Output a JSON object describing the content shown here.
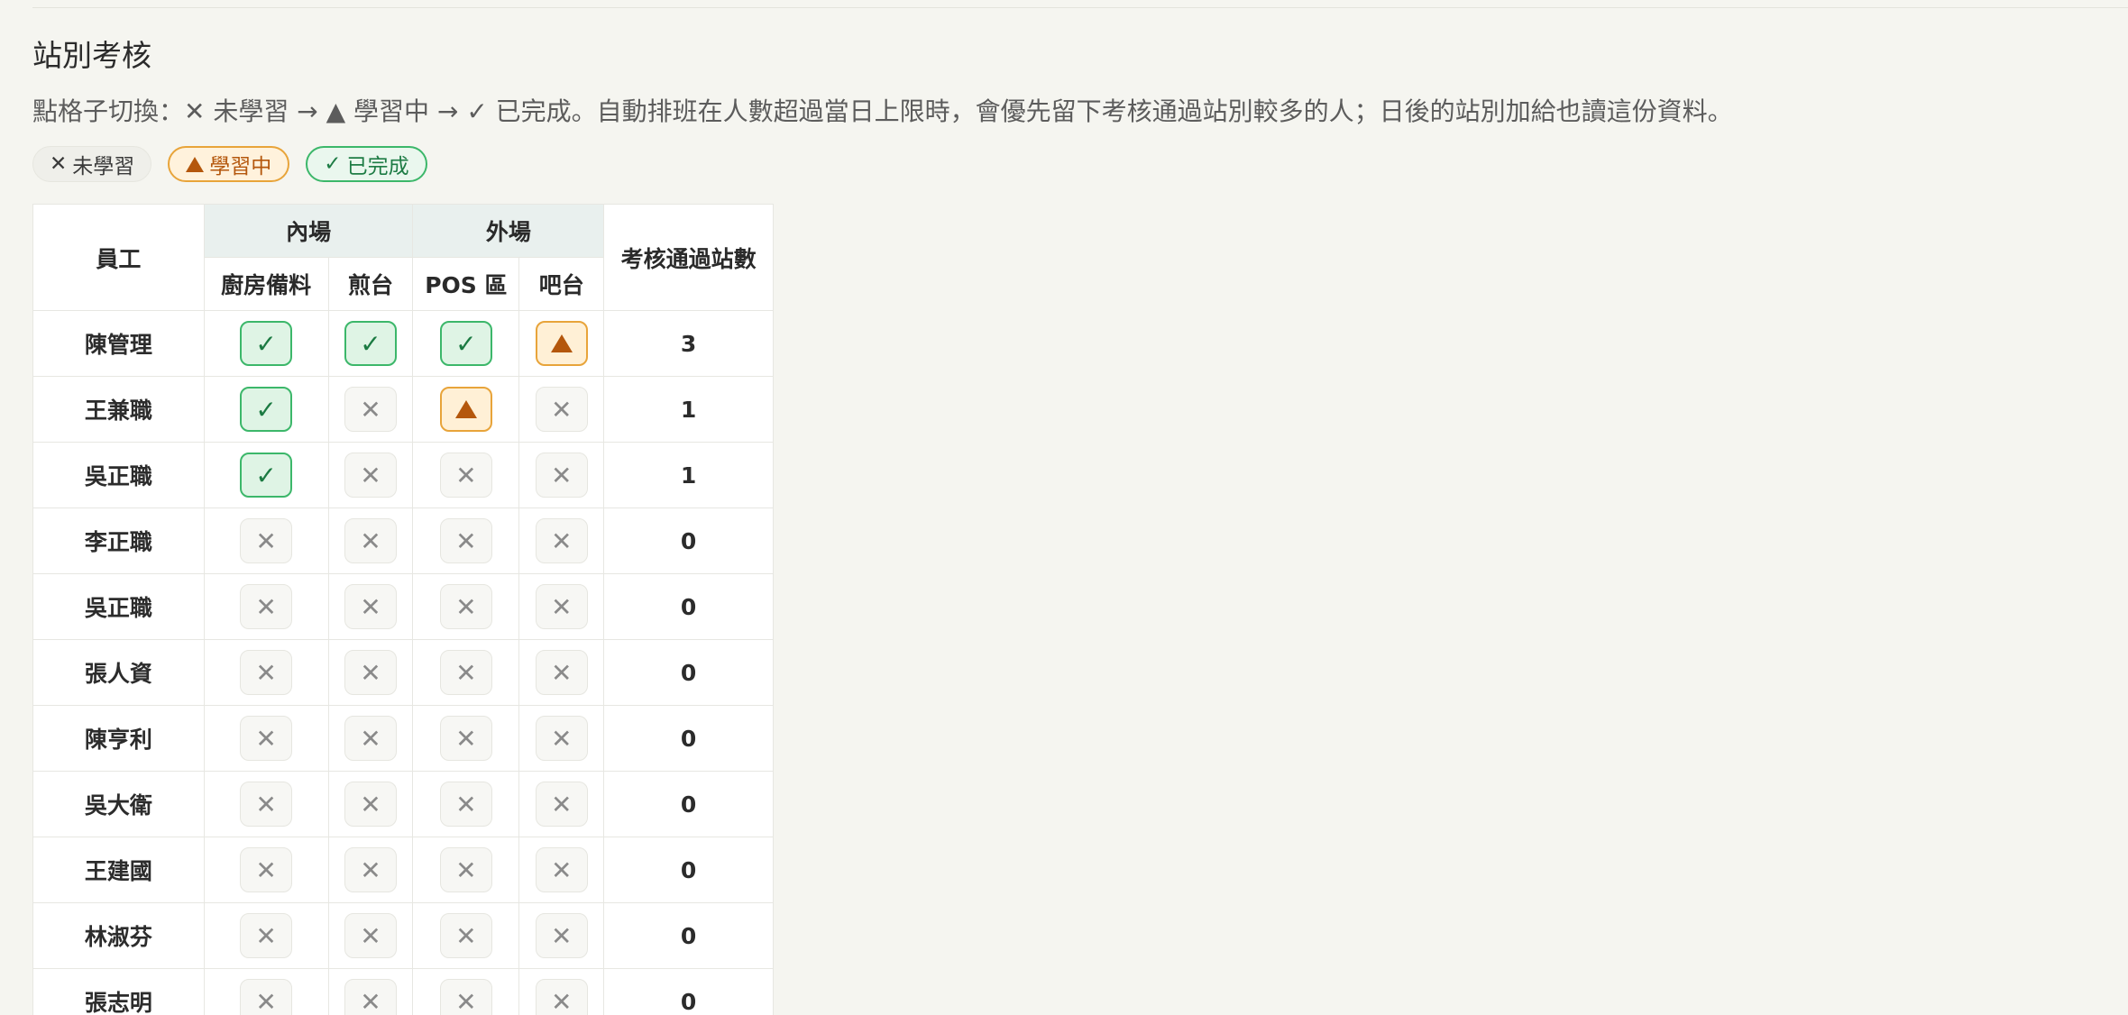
{
  "section": {
    "title": "站別考核",
    "instructions": "點格子切換：✕ 未學習 → ▲ 學習中 → ✓ 已完成。自動排班在人數超過當日上限時，會優先留下考核通過站別較多的人；日後的站別加給也讀這份資料。"
  },
  "legend": [
    {
      "state": "none",
      "symbol": "✕",
      "label": "未學習"
    },
    {
      "state": "learning",
      "symbol": "▲",
      "label": "學習中"
    },
    {
      "state": "done",
      "symbol": "✓",
      "label": "已完成"
    }
  ],
  "table": {
    "employee_header": "員工",
    "passed_header": "考核通過站數",
    "groups": [
      {
        "label": "內場",
        "stations": [
          "廚房備料",
          "煎台"
        ]
      },
      {
        "label": "外場",
        "stations": [
          "POS 區",
          "吧台"
        ]
      }
    ],
    "symbols": {
      "none": "✕",
      "learning": "▲",
      "done": "✓"
    },
    "rows": [
      {
        "name": "陳管理",
        "states": [
          "done",
          "done",
          "done",
          "learning"
        ],
        "passed": "3"
      },
      {
        "name": "王兼職",
        "states": [
          "done",
          "none",
          "learning",
          "none"
        ],
        "passed": "1"
      },
      {
        "name": "吳正職",
        "states": [
          "done",
          "none",
          "none",
          "none"
        ],
        "passed": "1"
      },
      {
        "name": "李正職",
        "states": [
          "none",
          "none",
          "none",
          "none"
        ],
        "passed": "0"
      },
      {
        "name": "吳正職",
        "states": [
          "none",
          "none",
          "none",
          "none"
        ],
        "passed": "0"
      },
      {
        "name": "張人資",
        "states": [
          "none",
          "none",
          "none",
          "none"
        ],
        "passed": "0"
      },
      {
        "name": "陳亨利",
        "states": [
          "none",
          "none",
          "none",
          "none"
        ],
        "passed": "0"
      },
      {
        "name": "吳大衛",
        "states": [
          "none",
          "none",
          "none",
          "none"
        ],
        "passed": "0"
      },
      {
        "name": "王建國",
        "states": [
          "none",
          "none",
          "none",
          "none"
        ],
        "passed": "0"
      },
      {
        "name": "林淑芬",
        "states": [
          "none",
          "none",
          "none",
          "none"
        ],
        "passed": "0"
      },
      {
        "name": "張志明",
        "states": [
          "none",
          "none",
          "none",
          "none"
        ],
        "passed": "0"
      }
    ]
  }
}
